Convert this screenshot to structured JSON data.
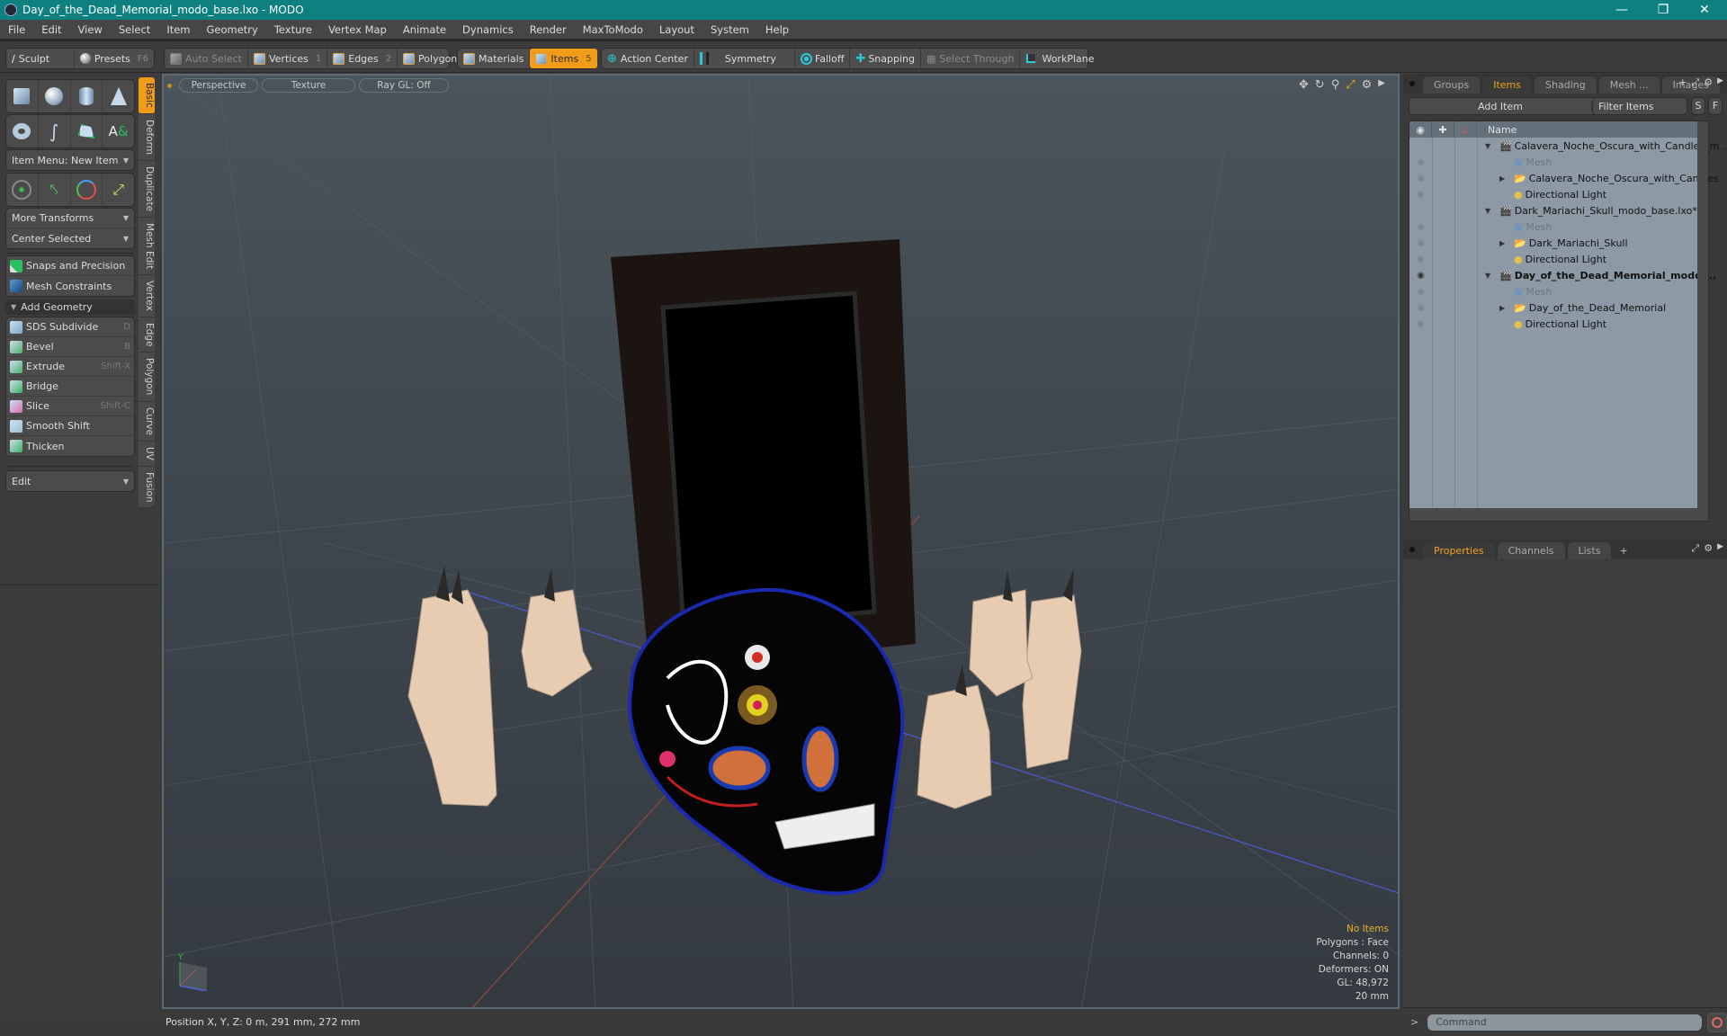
{
  "window": {
    "title": "Day_of_the_Dead_Memorial_modo_base.lxo - MODO",
    "controls": [
      "minimize",
      "restore",
      "close"
    ]
  },
  "menu": [
    "File",
    "Edit",
    "View",
    "Select",
    "Item",
    "Geometry",
    "Texture",
    "Vertex Map",
    "Animate",
    "Dynamics",
    "Render",
    "MaxToModo",
    "Layout",
    "System",
    "Help"
  ],
  "toolbar": {
    "sculpt": "Sculpt",
    "presets": "Presets",
    "presets_key": "F6",
    "auto_select": "Auto Select",
    "vertices": "Vertices",
    "vertices_key": "1",
    "edges": "Edges",
    "edges_key": "2",
    "polygons": "Polygons",
    "materials": "Materials",
    "items": "Items",
    "items_key": "5",
    "action_center": "Action Center",
    "symmetry": "Symmetry",
    "falloff": "Falloff",
    "snapping": "Snapping",
    "select_through": "Select Through",
    "workplane": "WorkPlane",
    "accent": "#f09b1a"
  },
  "leftpanel": {
    "item_menu": "Item Menu: New Item",
    "more_transforms": "More Transforms",
    "center_selected": "Center Selected",
    "snaps": "Snaps and Precision",
    "mesh_constraints": "Mesh Constraints",
    "add_geometry": "Add Geometry",
    "tools": [
      {
        "label": "SDS Subdivide",
        "key": "D",
        "color": "#7fa6c8"
      },
      {
        "label": "Bevel",
        "key": "B",
        "color": "#4caf6a"
      },
      {
        "label": "Extrude",
        "key": "Shift-X",
        "color": "#4caf6a"
      },
      {
        "label": "Bridge",
        "key": "",
        "color": "#3cb060"
      },
      {
        "label": "Slice",
        "key": "Shift-C",
        "color": "#d070b0"
      },
      {
        "label": "Smooth Shift",
        "key": "",
        "color": "#9fc0d8"
      },
      {
        "label": "Thicken",
        "key": "",
        "color": "#3cb060"
      }
    ],
    "edit_drop": "Edit",
    "vtabs": [
      "Basic",
      "Deform",
      "Duplicate",
      "Mesh Edit",
      "Vertex",
      "Edge",
      "Polygon",
      "Curve",
      "UV",
      "Fusion"
    ]
  },
  "viewport": {
    "view": "Perspective",
    "shading": "Texture",
    "raygl": "Ray GL: Off",
    "hud": {
      "selection": "No Items",
      "polygons": "Polygons : Face",
      "channels": "Channels: 0",
      "deformers": "Deformers: ON",
      "gl": "GL: 48,972",
      "grid": "20 mm"
    }
  },
  "status": {
    "position": "Position X, Y, Z:   0 m, 291 mm, 272 mm"
  },
  "items_panel": {
    "tabs": [
      "Groups",
      "Items",
      "Shading",
      "Mesh ...",
      "Images"
    ],
    "active_tab": "Items",
    "add_item": "Add Item",
    "filter_placeholder": "Filter Items",
    "s_btn": "S",
    "f_btn": "F",
    "col_name": "Name",
    "rows": [
      {
        "label": "Calavera_Noche_Oscura_with_Candles_m ...",
        "level": 0,
        "type": "scene",
        "eye": false
      },
      {
        "label": "Mesh",
        "level": 1,
        "type": "mesh",
        "eye": true,
        "dim": true
      },
      {
        "label": "Calavera_Noche_Oscura_with_Candles",
        "level": 1,
        "type": "group",
        "eye": true
      },
      {
        "label": "Directional Light",
        "level": 1,
        "type": "light",
        "eye": true
      },
      {
        "label": "Dark_Mariachi_Skull_modo_base.lxo*",
        "level": 0,
        "type": "scene",
        "eye": false
      },
      {
        "label": "Mesh",
        "level": 1,
        "type": "mesh",
        "eye": true,
        "dim": true
      },
      {
        "label": "Dark_Mariachi_Skull",
        "level": 1,
        "type": "group",
        "eye": true
      },
      {
        "label": "Directional Light",
        "level": 1,
        "type": "light",
        "eye": true
      },
      {
        "label": "Day_of_the_Dead_Memorial_modo ...",
        "level": 0,
        "type": "scene",
        "eye": true,
        "bold": true
      },
      {
        "label": "Mesh",
        "level": 1,
        "type": "mesh",
        "eye": true,
        "dim": true
      },
      {
        "label": "Day_of_the_Dead_Memorial",
        "level": 1,
        "type": "group",
        "eye": true
      },
      {
        "label": "Directional Light",
        "level": 1,
        "type": "light",
        "eye": true
      }
    ]
  },
  "props_panel": {
    "tabs": [
      "Properties",
      "Channels",
      "Lists"
    ],
    "active_tab": "Properties"
  },
  "command": {
    "prompt": ">",
    "placeholder": "Command"
  }
}
